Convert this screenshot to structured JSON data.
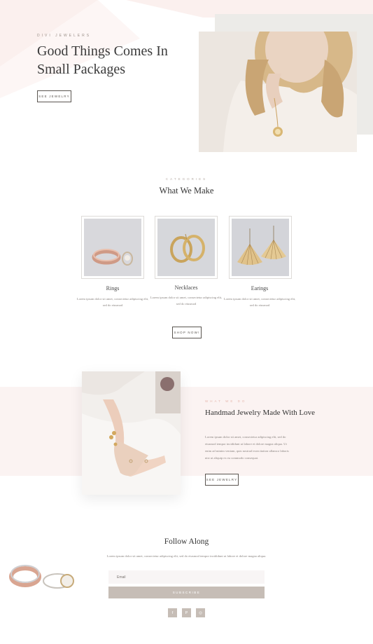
{
  "hero": {
    "kicker": "DIVI JEWELERS",
    "title": "Good Things Comes In Small Packages",
    "button_label": "SEE JEWELRY"
  },
  "categories": {
    "kicker": "CATEGORIES",
    "title": "What We Make",
    "items": [
      {
        "name": "Rings",
        "description": "Lorem ipsum dolor sit amet, consectetur adipiscing elit, sed do eiusmod"
      },
      {
        "name": "Necklaces",
        "description": "Lorem ipsum dolor sit amet, consectetur adipiscing elit, sed do eiusmod"
      },
      {
        "name": "Earings",
        "description": "Lorem ipsum dolor sit amet, consectetur adipiscing elit, sed do eiusmod"
      }
    ],
    "button_label": "SHOP NOW!"
  },
  "about": {
    "kicker": "WHAT WE DO",
    "title": "Handmad Jewelry Made With Love",
    "text": "Lorem ipsum dolor sit amet, consectetur adipiscing elit, sed do eiusmod tempor incididunt ut labore et dolore magna aliqua. Ut enim ad minim veniam, quis nostrud exercitation ullamco laboris nisi ut aliquip ex ea commodo consequat.",
    "button_label": "SEE JEWELRY"
  },
  "follow": {
    "title": "Follow Along",
    "text": "Lorem ipsum dolor sit amet, consectetur adipiscing elit, sed do eiusmod tempor incididunt ut labore et dolore magna aliqua.",
    "email_placeholder": "Email",
    "subscribe_label": "SUBSCRIBE",
    "social": [
      {
        "icon": "facebook-icon",
        "glyph": "f"
      },
      {
        "icon": "pinterest-icon",
        "glyph": "P"
      },
      {
        "icon": "instagram-icon",
        "glyph": "◎"
      }
    ]
  },
  "colors": {
    "accent_pink": "#fbf3f2",
    "button_taupe": "#c6bdb6",
    "kicker_rose": "#e6b8ae"
  }
}
